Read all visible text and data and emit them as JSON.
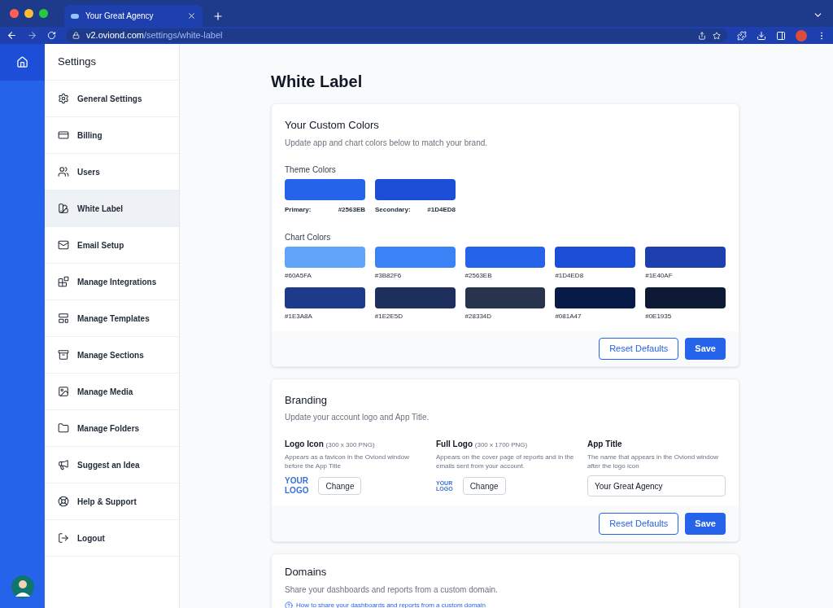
{
  "browser": {
    "tab_title": "Your Great Agency",
    "url_host": "v2.oviond.com",
    "url_path": "/settings/white-label"
  },
  "settings_nav": {
    "title": "Settings",
    "items": [
      {
        "label": "General Settings",
        "selected": false
      },
      {
        "label": "Billing",
        "selected": false
      },
      {
        "label": "Users",
        "selected": false
      },
      {
        "label": "White Label",
        "selected": true
      },
      {
        "label": "Email Setup",
        "selected": false
      },
      {
        "label": "Manage Integrations",
        "selected": false
      },
      {
        "label": "Manage Templates",
        "selected": false
      },
      {
        "label": "Manage Sections",
        "selected": false
      },
      {
        "label": "Manage Media",
        "selected": false
      },
      {
        "label": "Manage Folders",
        "selected": false
      },
      {
        "label": "Suggest an Idea",
        "selected": false
      },
      {
        "label": "Help & Support",
        "selected": false
      },
      {
        "label": "Logout",
        "selected": false
      }
    ]
  },
  "page_title": "White Label",
  "custom_colors": {
    "title": "Your Custom Colors",
    "subtitle": "Update app and chart colors below to match your brand.",
    "theme_label": "Theme Colors",
    "theme_colors": [
      {
        "name": "Primary:",
        "hex": "#2563EB",
        "color": "#2563eb"
      },
      {
        "name": "Secondary:",
        "hex": "#1D4ED8",
        "color": "#1d4ed8"
      }
    ],
    "chart_label": "Chart Colors",
    "chart_colors": [
      {
        "hex": "#60A5FA",
        "color": "#60a5fa"
      },
      {
        "hex": "#3B82F6",
        "color": "#3b82f6"
      },
      {
        "hex": "#2563EB",
        "color": "#2563eb"
      },
      {
        "hex": "#1D4ED8",
        "color": "#1d4ed8"
      },
      {
        "hex": "#1E40AF",
        "color": "#1e40af"
      },
      {
        "hex": "#1E3A8A",
        "color": "#1e3a8a"
      },
      {
        "hex": "#1E2E5D",
        "color": "#1e2e5d"
      },
      {
        "hex": "#28334D",
        "color": "#28334d"
      },
      {
        "hex": "#081A47",
        "color": "#081a47"
      },
      {
        "hex": "#0E1935",
        "color": "#0e1935"
      }
    ],
    "buttons": [
      "Reset Defaults",
      "Save"
    ]
  },
  "branding": {
    "title": "Branding",
    "subtitle": "Update your account logo and App Title.",
    "logo_icon": {
      "label": "Logo Icon",
      "size": "(300 x 300 PNG)",
      "help": "Appears as a favicon in the Oviond window before the App Title",
      "logo": [
        "YOUR",
        "LOGO"
      ],
      "button": "Change"
    },
    "full_logo": {
      "label": "Full Logo",
      "size": "(300 x 1700 PNG)",
      "help": "Appears on the cover page of reports and in the emails sent from your account.",
      "logo": [
        "YOUR",
        "LOGO"
      ],
      "button": "Change"
    },
    "app_title": {
      "label": "App Title",
      "help": "The name that appears in the Oviond window after the logo icon",
      "value": "Your Great Agency"
    },
    "buttons": [
      "Reset Defaults",
      "Save"
    ]
  },
  "domains": {
    "title": "Domains",
    "subtitle": "Share your dashboards and reports from a custom domain.",
    "link": "How to share your dashboards and reports from a custom domain"
  }
}
